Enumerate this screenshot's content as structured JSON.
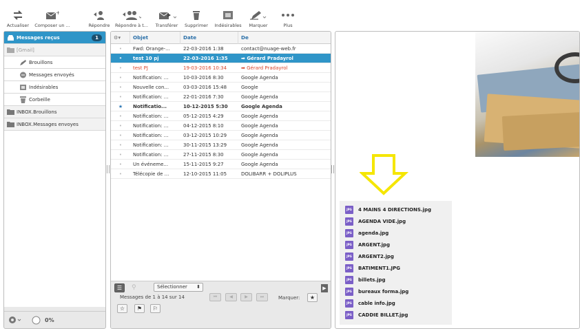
{
  "toolbar": {
    "refresh": "Actualiser",
    "compose": "Composer un ...",
    "reply": "Répondre",
    "reply_all": "Répondre à t...",
    "forward": "Transférer",
    "delete": "Supprimer",
    "junk": "Indésirables",
    "mark": "Marquer",
    "more": "Plus"
  },
  "folders": [
    {
      "label": "Messages reçus",
      "badge": "1"
    },
    {
      "label": "[Gmail]"
    },
    {
      "label": "Brouillons"
    },
    {
      "label": "Messages envoyés"
    },
    {
      "label": "Indésirables"
    },
    {
      "label": "Corbeille"
    },
    {
      "label": "INBOX.Brouillons"
    },
    {
      "label": "INBOX.Messages envoyes"
    }
  ],
  "left_footer": {
    "quota": "0%"
  },
  "columns": {
    "subject": "Objet",
    "date": "Date",
    "from": "De"
  },
  "messages": [
    {
      "subject": "Fwd: Orange-...",
      "date": "22-03-2016 1:38",
      "from": "contact@nuage-web.fr"
    },
    {
      "subject": "test 10 pj",
      "date": "22-03-2016 1:35",
      "from": "Gérard Pradayrol"
    },
    {
      "subject": "test PJ",
      "date": "19-03-2016 10:34",
      "from": "Gérard Pradayrol"
    },
    {
      "subject": "Notification: ...",
      "date": "10-03-2016 8:30",
      "from": "Google Agenda"
    },
    {
      "subject": "Nouvelle con...",
      "date": "03-03-2016 15:48",
      "from": "Google"
    },
    {
      "subject": "Notification: ...",
      "date": "22-01-2016 7:30",
      "from": "Google Agenda"
    },
    {
      "subject": "Notificatio...",
      "date": "10-12-2015 5:30",
      "from": "Google Agenda"
    },
    {
      "subject": "Notification: ...",
      "date": "05-12-2015 4:29",
      "from": "Google Agenda"
    },
    {
      "subject": "Notification: ...",
      "date": "04-12-2015 8:10",
      "from": "Google Agenda"
    },
    {
      "subject": "Notification: ...",
      "date": "03-12-2015 10:29",
      "from": "Google Agenda"
    },
    {
      "subject": "Notification: ...",
      "date": "30-11-2015 13:29",
      "from": "Google Agenda"
    },
    {
      "subject": "Notification: ...",
      "date": "27-11-2015 8:30",
      "from": "Google Agenda"
    },
    {
      "subject": "Un événeme...",
      "date": "15-11-2015 9:27",
      "from": "Google Agenda"
    },
    {
      "subject": "Télécopie de ...",
      "date": "12-10-2015 11:05",
      "from": "DOLIBARR + DOLIPLUS"
    }
  ],
  "list_footer": {
    "select_label": "Sélectionner",
    "count_text": "Messages de 1 à 14 sur 14",
    "mark_label": "Marquer:"
  },
  "attachments": [
    "4 MAINS 4 DIRECTIONS.jpg",
    "AGENDA VIDE.jpg",
    "agenda.jpg",
    "ARGENT.jpg",
    "ARGENT2.jpg",
    "BATIMENT1.JPG",
    "billets.jpg",
    "bureaux forma.jpg",
    "cable info.jpg",
    "CADDIE BILLET.jpg"
  ],
  "colors": {
    "accent": "#2f95c8",
    "unread_red": "#d8452b",
    "arrow": "#f5e600"
  }
}
